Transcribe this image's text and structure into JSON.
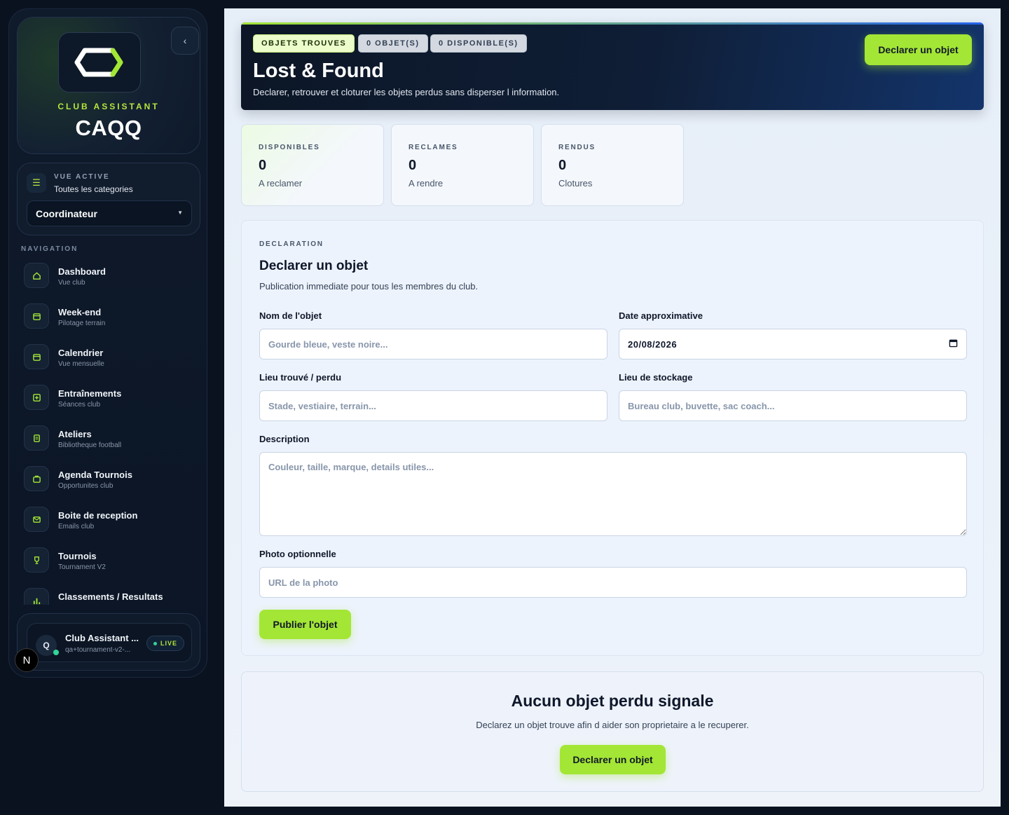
{
  "brand": {
    "subtitle": "CLUB ASSISTANT",
    "name": "CAQQ",
    "collapse_icon": "chevron-left-icon"
  },
  "view": {
    "kicker": "VUE ACTIVE",
    "value": "Toutes les categories",
    "role": "Coordinateur"
  },
  "nav": {
    "title": "NAVIGATION",
    "items": [
      {
        "label": "Dashboard",
        "sub": "Vue club",
        "icon": "home-icon"
      },
      {
        "label": "Week-end",
        "sub": "Pilotage terrain",
        "icon": "calendar-icon"
      },
      {
        "label": "Calendrier",
        "sub": "Vue mensuelle",
        "icon": "calendar-icon"
      },
      {
        "label": "Entraînements",
        "sub": "Séances club",
        "icon": "training-icon"
      },
      {
        "label": "Ateliers",
        "sub": "Bibliotheque football",
        "icon": "clipboard-icon"
      },
      {
        "label": "Agenda Tournois",
        "sub": "Opportunites club",
        "icon": "briefcase-icon"
      },
      {
        "label": "Boite de reception",
        "sub": "Emails club",
        "icon": "inbox-icon"
      },
      {
        "label": "Tournois",
        "sub": "Tournament V2",
        "icon": "trophy-icon"
      },
      {
        "label": "Classements / Resultats",
        "sub": "",
        "icon": "ranking-icon"
      }
    ]
  },
  "user": {
    "initial": "Q",
    "name": "Club Assistant ...",
    "email": "qa+tournament-v2-...",
    "status": "LIVE"
  },
  "n_badge": "N",
  "hero": {
    "chips": [
      "OBJETS TROUVES",
      "0 OBJET(S)",
      "0 DISPONIBLE(S)"
    ],
    "title": "Lost & Found",
    "subtitle": "Declarer, retrouver et cloturer les objets perdus sans disperser l information.",
    "button": "Declarer un objet"
  },
  "stats": [
    {
      "kicker": "DISPONIBLES",
      "value": "0",
      "sub": "A reclamer"
    },
    {
      "kicker": "RECLAMES",
      "value": "0",
      "sub": "A rendre"
    },
    {
      "kicker": "RENDUS",
      "value": "0",
      "sub": "Clotures"
    }
  ],
  "form": {
    "kicker": "DECLARATION",
    "title": "Declarer un objet",
    "subtitle": "Publication immediate pour tous les membres du club.",
    "name_label": "Nom de l'objet",
    "name_placeholder": "Gourde bleue, veste noire...",
    "date_label": "Date approximative",
    "date_value": "20/08/2026",
    "place_label": "Lieu trouvé / perdu",
    "place_placeholder": "Stade, vestiaire, terrain...",
    "storage_label": "Lieu de stockage",
    "storage_placeholder": "Bureau club, buvette, sac coach...",
    "desc_label": "Description",
    "desc_placeholder": "Couleur, taille, marque, details utiles...",
    "photo_label": "Photo optionnelle",
    "photo_placeholder": "URL de la photo",
    "submit": "Publier l'objet"
  },
  "empty": {
    "title": "Aucun objet perdu signale",
    "subtitle": "Declarez un objet trouve afin d aider son proprietaire a le recuperer.",
    "button": "Declarer un objet"
  },
  "colors": {
    "accent": "#a3e635",
    "sidebar_bg": "#0b1525",
    "hero_bg": "#0f1e36"
  }
}
